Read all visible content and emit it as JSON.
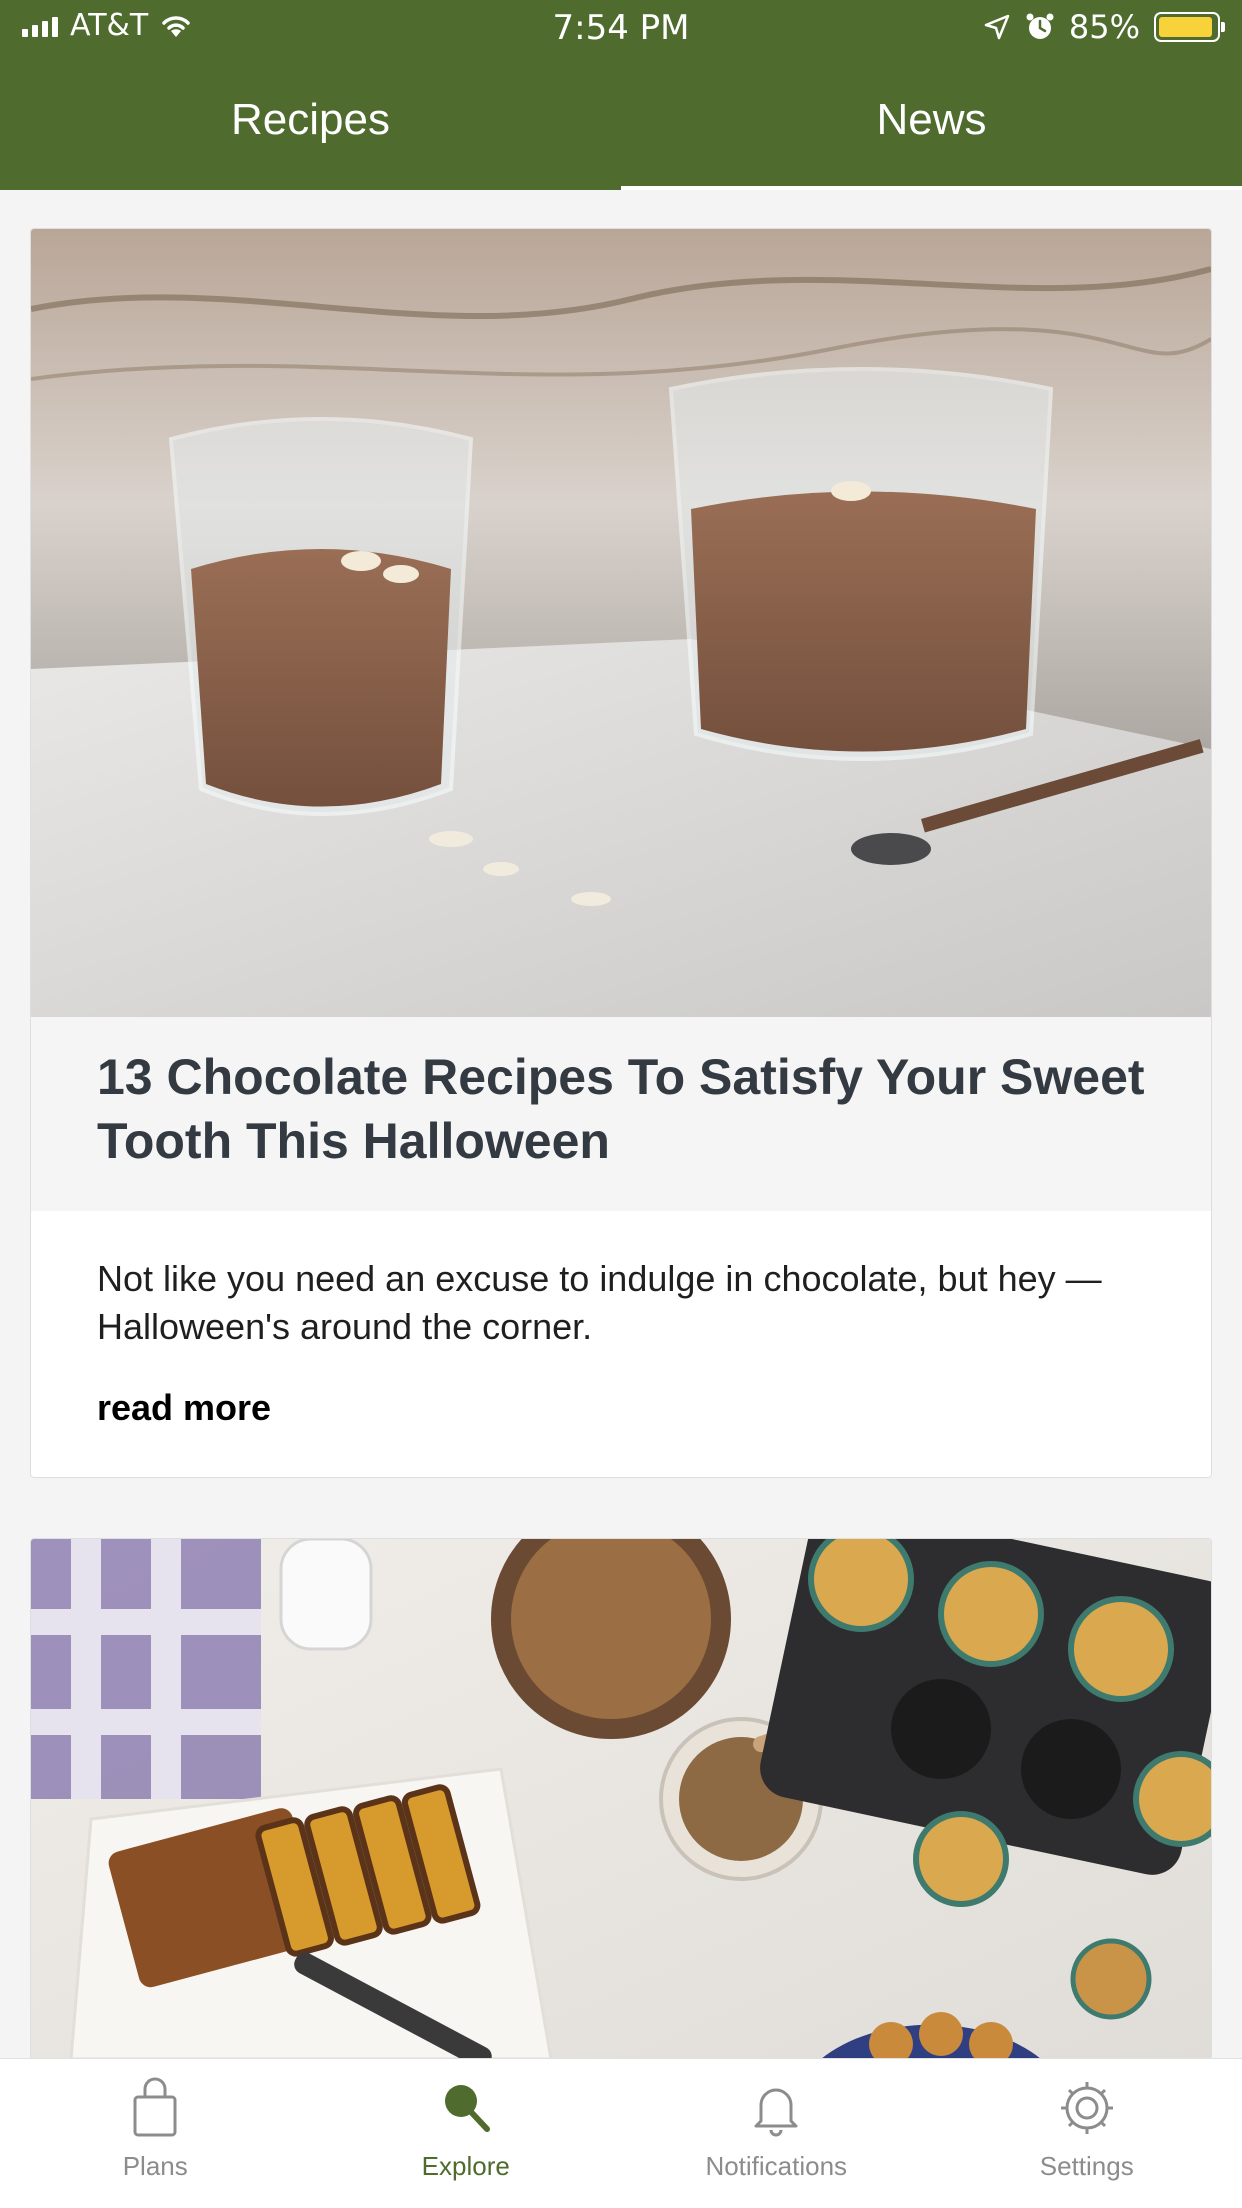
{
  "status_bar": {
    "carrier": "AT&T",
    "time": "7:54 PM",
    "battery": "85%",
    "icons": [
      "signal-icon",
      "wifi-icon",
      "location-icon",
      "alarm-icon",
      "battery-icon"
    ]
  },
  "tabs": [
    {
      "label": "Recipes",
      "active": false
    },
    {
      "label": "News",
      "active": true
    }
  ],
  "articles": [
    {
      "title": "13 Chocolate Recipes To Satisfy Your Sweet Tooth This Halloween",
      "description": "Not like you need an excuse to indulge in chocolate, but hey — Halloween's around the corner.",
      "read_more": "read more"
    }
  ],
  "bottom_nav": [
    {
      "label": "Plans",
      "icon": "shopping-bag-icon"
    },
    {
      "label": "Explore",
      "icon": "search-icon",
      "active": true
    },
    {
      "label": "Notifications",
      "icon": "bell-icon"
    },
    {
      "label": "Settings",
      "icon": "gear-icon"
    }
  ],
  "colors": {
    "brand": "#4f6b2e",
    "title": "#333a42",
    "nav_inactive": "#8c8c8c"
  }
}
